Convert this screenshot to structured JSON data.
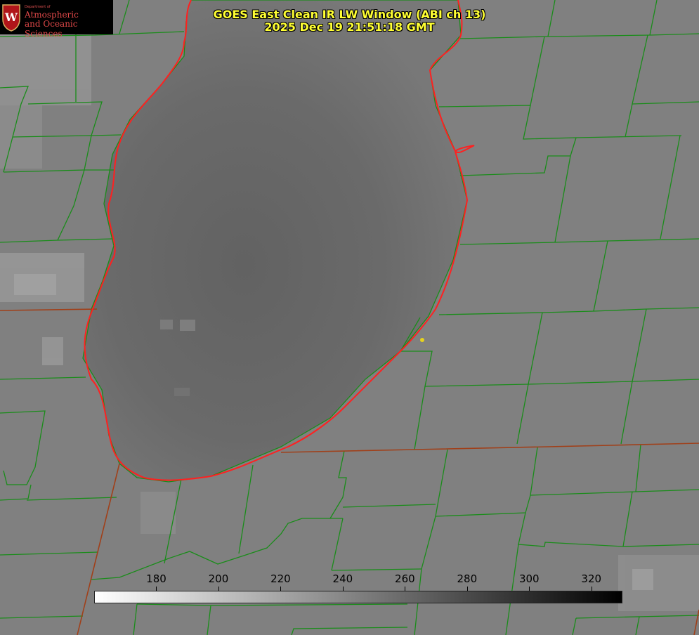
{
  "title_line1": "GOES East Clean IR LW Window (ABI ch 13)",
  "title_line2": "2025 Dec 19 21:51:18 GMT",
  "logo": {
    "dept": "Department of",
    "line1": "Atmospheric",
    "line2": "and Oceanic Sciences",
    "seal_letter": "W"
  },
  "colors": {
    "title": "#ffff33",
    "county_lines": "#1a8c1a",
    "state_lines": "#a0401a",
    "coastline": "#ff2020",
    "marker": "#e6d21e"
  },
  "colorbar": {
    "min": 160,
    "max": 330,
    "ticks": [
      "180",
      "200",
      "220",
      "240",
      "260",
      "280",
      "300",
      "320"
    ]
  }
}
